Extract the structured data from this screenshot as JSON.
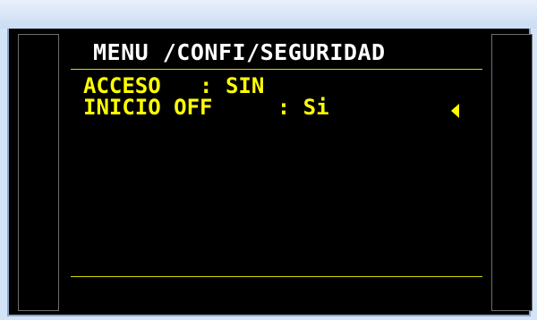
{
  "screen": {
    "title": "MENU /CONFI/SEGURIDAD",
    "rows": [
      {
        "label": "ACCESO",
        "value": "SIN"
      },
      {
        "label": "INICIO OFF",
        "value": "Si"
      }
    ],
    "selected_row": 2
  },
  "colors": {
    "background": "#000000",
    "title_text": "#ffffff",
    "menu_text": "#ffff00",
    "rule": "#d7d700",
    "window_frame": "#8aa4c8"
  },
  "icons": {
    "selection_cursor": "caret-left-icon"
  }
}
